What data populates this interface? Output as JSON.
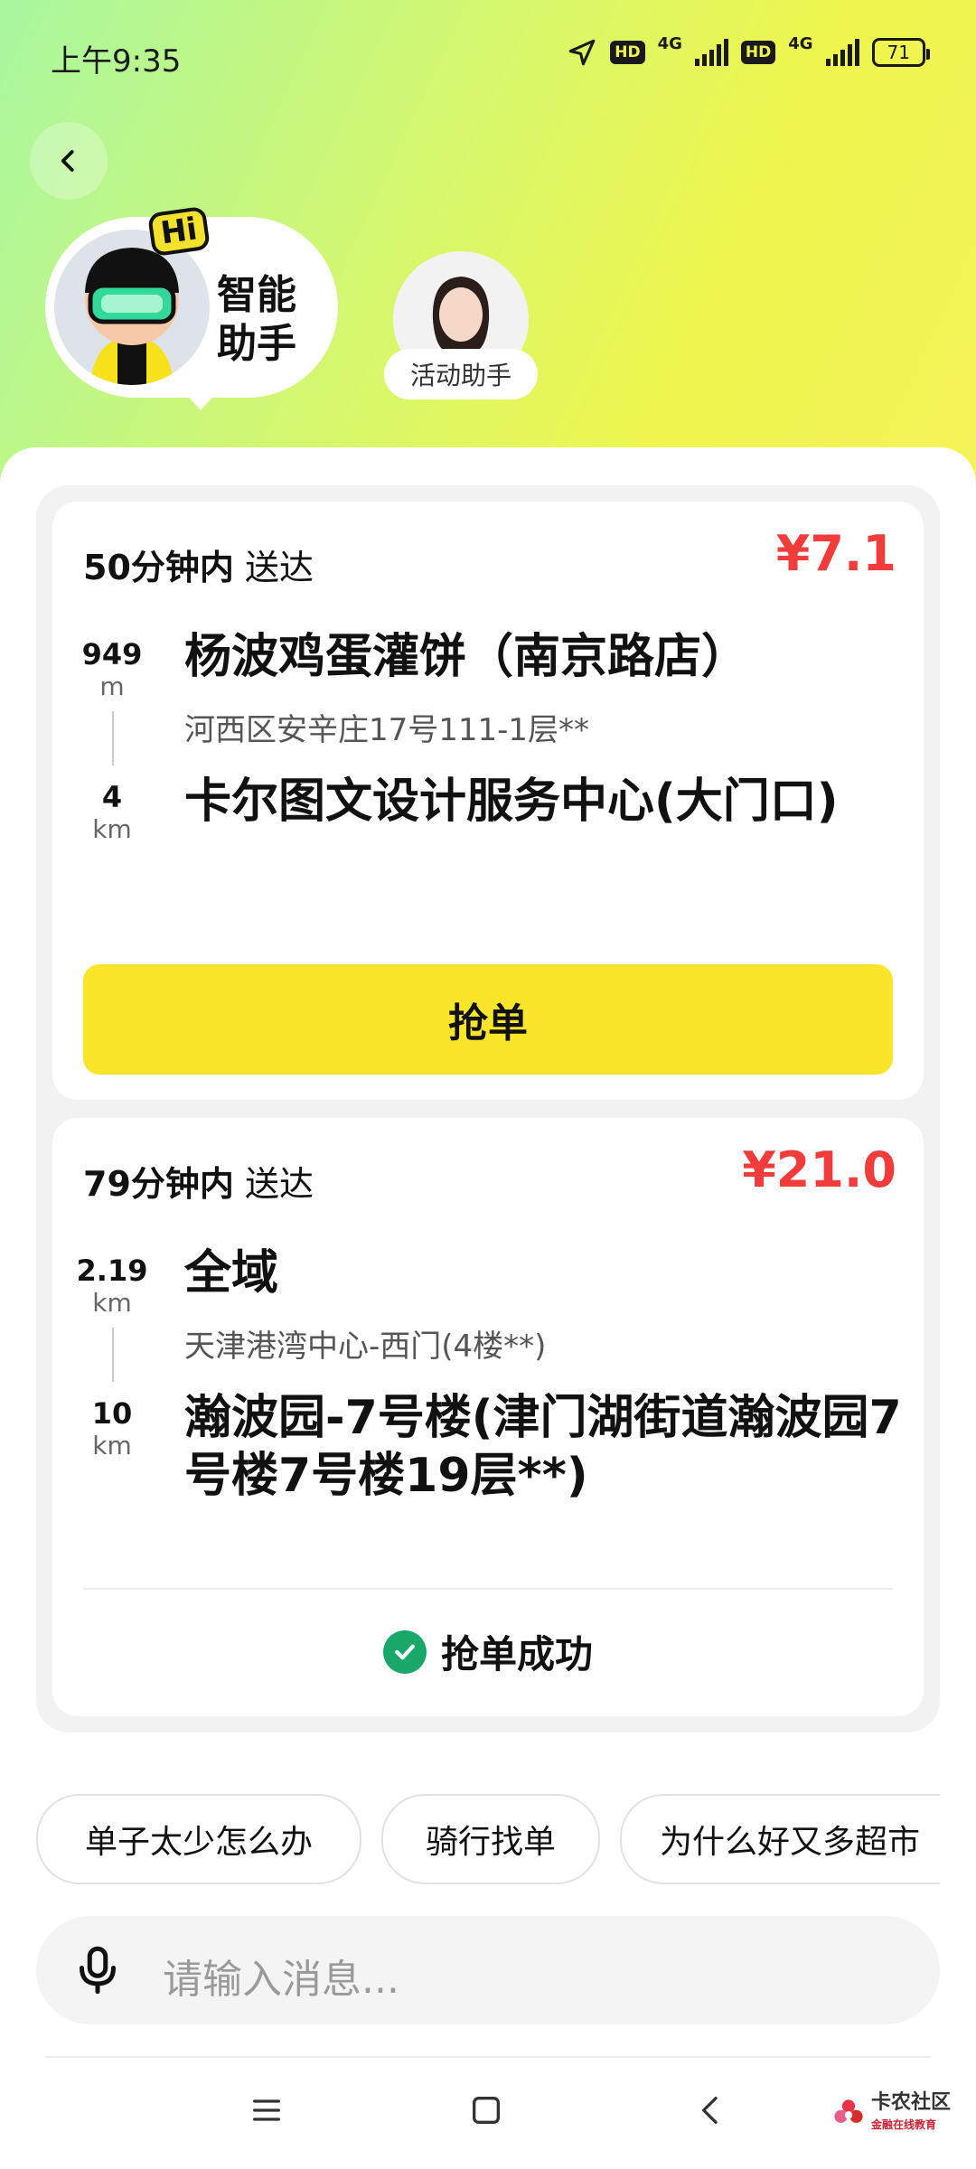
{
  "status_bar": {
    "time": "上午9:35",
    "hd1": "HD",
    "net1": "4G",
    "hd2": "HD",
    "net2": "4G",
    "battery": "71"
  },
  "assistants": {
    "main_label": "智能助手",
    "hi_badge": "Hi",
    "activity_label": "活动助手"
  },
  "orders": [
    {
      "eta_time": "50分钟内",
      "eta_suffix": "送达",
      "price": "¥7.1",
      "pickup": {
        "distance": "949",
        "unit": "m",
        "title": "杨波鸡蛋灌饼（南京路店）",
        "subtitle": "河西区安辛庄17号111-1层**"
      },
      "dropoff": {
        "distance": "4",
        "unit": "km",
        "title": "卡尔图文设计服务中心(大门口)"
      },
      "action": "抢单"
    },
    {
      "eta_time": "79分钟内",
      "eta_suffix": "送达",
      "price": "¥21.0",
      "pickup": {
        "distance": "2.19",
        "unit": "km",
        "title": "全域",
        "subtitle": "天津港湾中心-西门(4楼**)"
      },
      "dropoff": {
        "distance": "10",
        "unit": "km",
        "title": "瀚波园-7号楼(津门湖街道瀚波园7号楼7号楼19层**)"
      },
      "status": "抢单成功"
    }
  ],
  "quick_replies": [
    "单子太少怎么办",
    "骑行找单",
    "为什么好又多超市"
  ],
  "input": {
    "placeholder": "请输入消息..."
  },
  "watermark": {
    "brand": "卡农社区",
    "sub": "金融在线教育"
  },
  "colors": {
    "accent_yellow": "#fae52b",
    "price_red": "#f23b3b",
    "success_green": "#1aa86a"
  }
}
